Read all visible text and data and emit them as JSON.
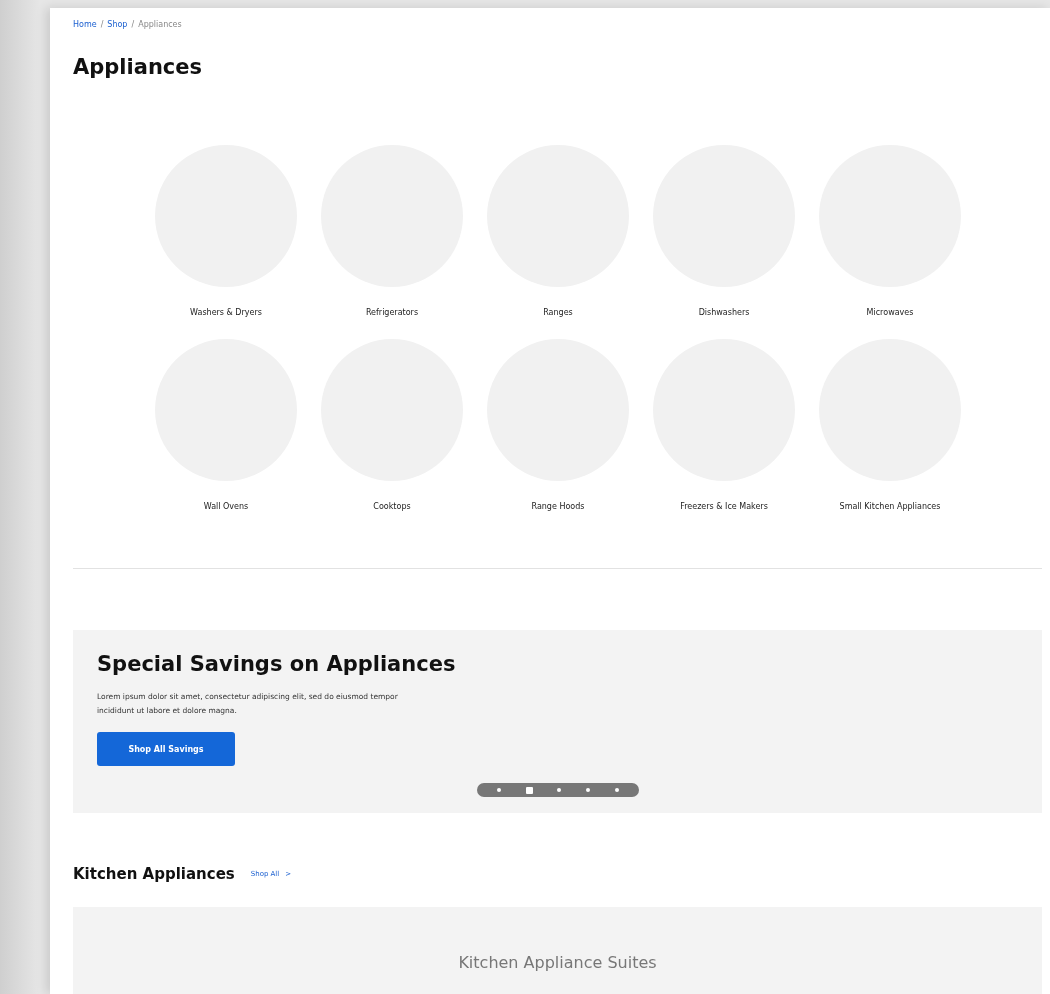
{
  "breadcrumb": [
    {
      "label": "Home",
      "link": true
    },
    {
      "label": "Shop",
      "link": true
    },
    {
      "label": "Appliances",
      "link": false
    }
  ],
  "breadcrumb_separator": "/",
  "title": "Appliances",
  "categories": [
    {
      "label": "Washers & Dryers"
    },
    {
      "label": "Refrigerators"
    },
    {
      "label": "Ranges"
    },
    {
      "label": "Dishwashers"
    },
    {
      "label": "Microwaves"
    },
    {
      "label": "Wall Ovens"
    },
    {
      "label": "Cooktops"
    },
    {
      "label": "Range Hoods"
    },
    {
      "label": "Freezers & Ice Makers"
    },
    {
      "label": "Small Kitchen Appliances"
    }
  ],
  "promo": {
    "title": "Special Savings on Appliances",
    "text": "Lorem ipsum dolor sit amet, consectetur adipiscing elit, sed do eiusmod tempor incididunt ut labore et dolore magna.",
    "button": "Shop All Savings",
    "slides": [
      {
        "selected": false
      },
      {
        "selected": true
      },
      {
        "selected": false
      },
      {
        "selected": false
      },
      {
        "selected": false
      }
    ]
  },
  "section": {
    "title": "Kitchen Appliances",
    "link": "Shop All",
    "link_icon": ">"
  },
  "card": {
    "title": "Kitchen Appliance Suites"
  }
}
